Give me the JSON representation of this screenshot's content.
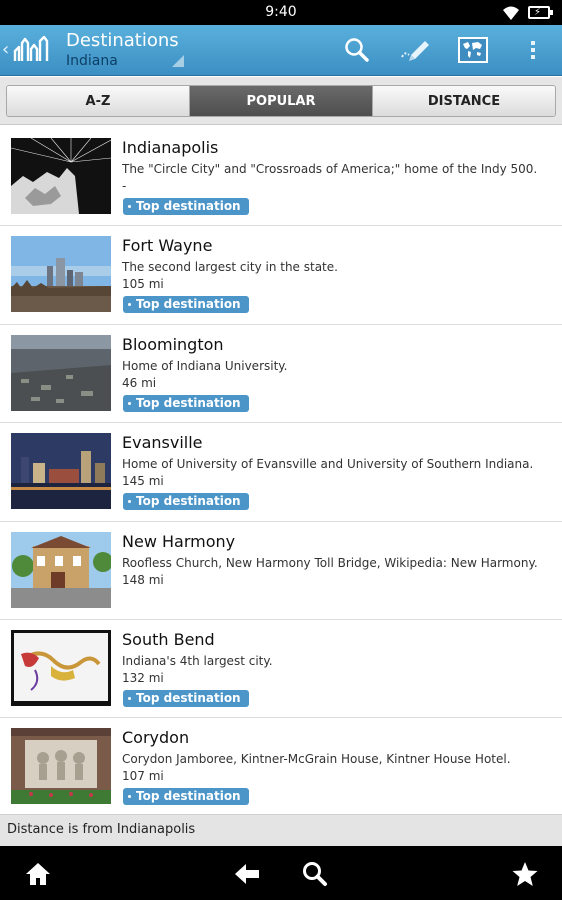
{
  "status": {
    "time": "9:40"
  },
  "header": {
    "title": "Destinations",
    "subtitle": "Indiana"
  },
  "tabs": [
    {
      "label": "A-Z",
      "active": false
    },
    {
      "label": "POPULAR",
      "active": true
    },
    {
      "label": "DISTANCE",
      "active": false
    }
  ],
  "items": [
    {
      "name": "Indianapolis",
      "desc": "The \"Circle City\" and \"Crossroads of America;\" home of the Indy 500.",
      "dist": "-",
      "badge": "Top destination"
    },
    {
      "name": "Fort Wayne",
      "desc": "The second largest city in the state.",
      "dist": "105 mi",
      "badge": "Top destination"
    },
    {
      "name": "Bloomington",
      "desc": "Home of Indiana University.",
      "dist": "46 mi",
      "badge": "Top destination"
    },
    {
      "name": "Evansville",
      "desc": "Home of University of Evansville and University of Southern Indiana.",
      "dist": "145 mi",
      "badge": "Top destination"
    },
    {
      "name": "New Harmony",
      "desc": "Roofless Church, New Harmony Toll Bridge, Wikipedia: New Harmony.",
      "dist": "148 mi",
      "badge": ""
    },
    {
      "name": "South Bend",
      "desc": "Indiana's 4th largest city.",
      "dist": "132 mi",
      "badge": "Top destination"
    },
    {
      "name": "Corydon",
      "desc": "Corydon Jamboree, Kintner-McGrain House, Kintner House Hotel.",
      "dist": "107 mi",
      "badge": "Top destination"
    }
  ],
  "footer_note": "Distance is from Indianapolis",
  "colors": {
    "actionbar": "#4aa0d0",
    "badge": "#4b95c9",
    "active_tab": "#5a5a5a"
  }
}
